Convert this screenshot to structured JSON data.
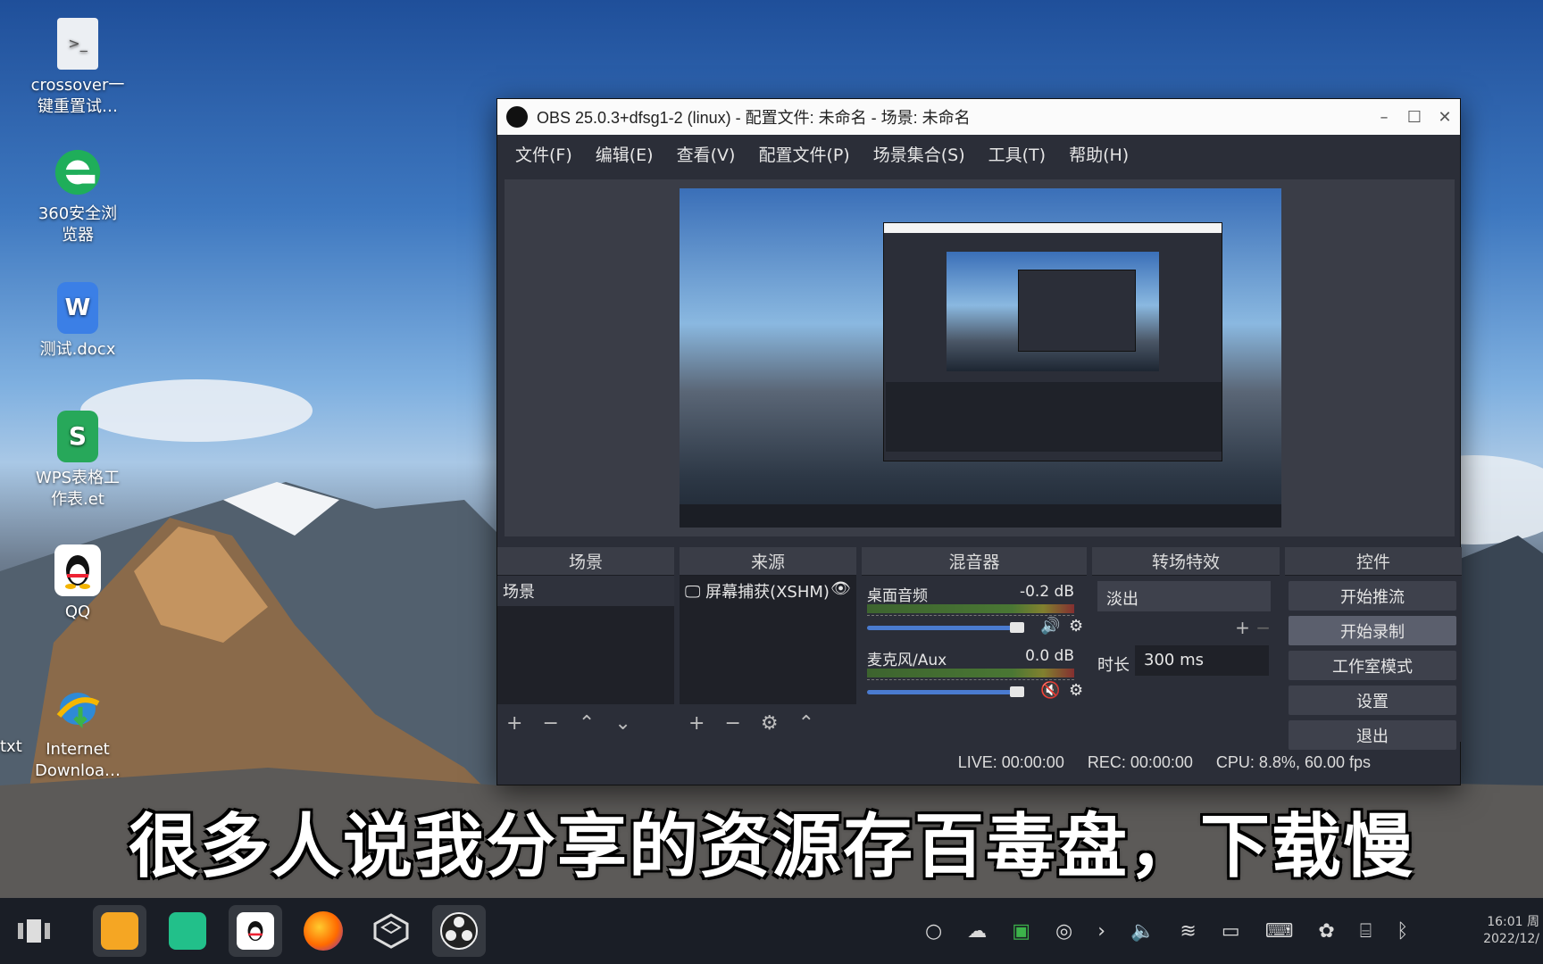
{
  "desktop": {
    "icons": [
      {
        "name": "crossover-script",
        "label_line1": "crossover一",
        "label_line2": "键重置试…"
      },
      {
        "name": "360-browser",
        "label_line1": "360安全浏",
        "label_line2": "览器"
      },
      {
        "name": "test-docx",
        "label_line1": "测试.docx",
        "label_line2": ""
      },
      {
        "name": "wps-et",
        "label_line1": "WPS表格工",
        "label_line2": "作表.et"
      },
      {
        "name": "qq",
        "label_line1": "QQ",
        "label_line2": ""
      },
      {
        "name": "internet-download",
        "label_line1": "Internet",
        "label_line2": "Downloa…"
      }
    ],
    "partial_label": "txt"
  },
  "obs": {
    "title": "OBS 25.0.3+dfsg1-2 (linux) - 配置文件: 未命名 - 场景: 未命名",
    "menu": [
      "文件(F)",
      "编辑(E)",
      "查看(V)",
      "配置文件(P)",
      "场景集合(S)",
      "工具(T)",
      "帮助(H)"
    ],
    "docks": {
      "scenes": {
        "title": "场景",
        "items": [
          "场景"
        ]
      },
      "sources": {
        "title": "来源",
        "items": [
          "屏幕捕获(XSHM)"
        ]
      },
      "mixer": {
        "title": "混音器",
        "channels": [
          {
            "name": "桌面音频",
            "db": "-0.2 dB",
            "volume": 0.92,
            "muted": false
          },
          {
            "name": "麦克风/Aux",
            "db": "0.0 dB",
            "volume": 0.92,
            "muted": true
          }
        ]
      },
      "transitions": {
        "title": "转场特效",
        "selected": "淡出",
        "duration_label": "时长",
        "duration_value": "300 ms"
      },
      "controls": {
        "title": "控件",
        "buttons": [
          "开始推流",
          "开始录制",
          "工作室模式",
          "设置",
          "退出"
        ]
      }
    },
    "status": {
      "live": "LIVE: 00:00:00",
      "rec": "REC: 00:00:00",
      "cpu": "CPU: 8.8%, 60.00 fps"
    }
  },
  "subtitle": "很多人说我分享的资源存百毒盘，下载慢",
  "taskbar": {
    "clock_time": "16:01 周",
    "clock_date": "2022/12/"
  }
}
